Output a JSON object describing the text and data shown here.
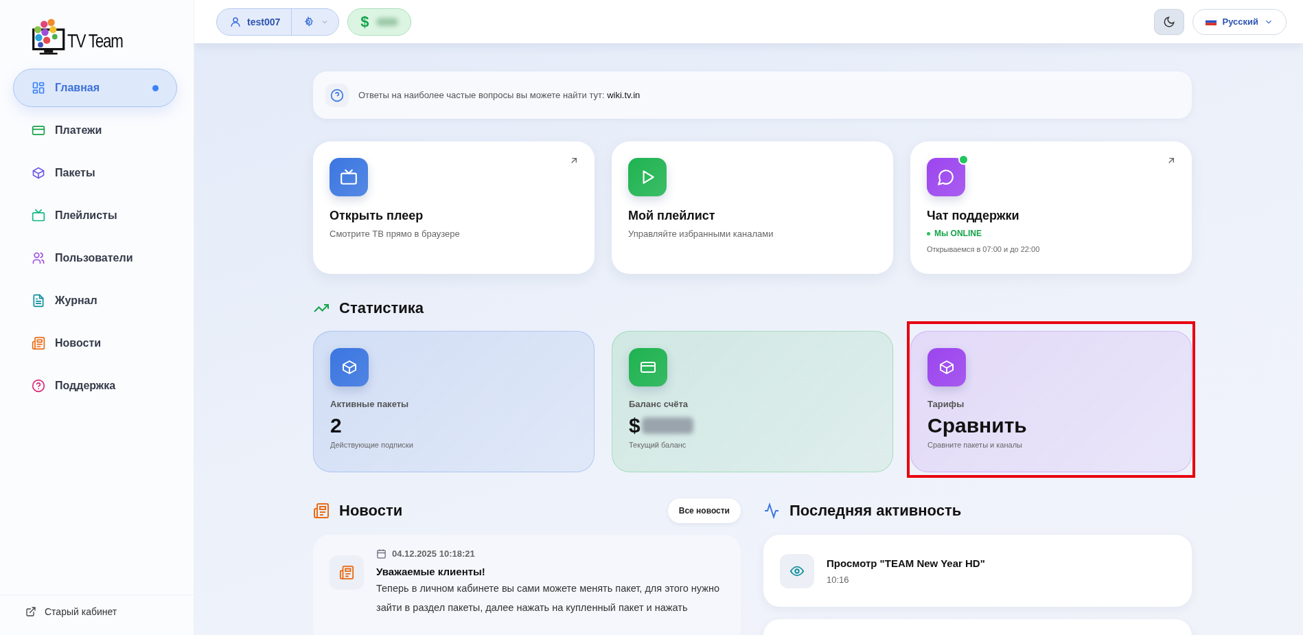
{
  "logo": {
    "text": "TV Team"
  },
  "sidebar": {
    "items": [
      {
        "label": "Главная",
        "selected": true,
        "color": "#3b82f6"
      },
      {
        "label": "Платежи",
        "selected": false,
        "color": "#16a34a"
      },
      {
        "label": "Пакеты",
        "selected": false,
        "color": "#6d5be6"
      },
      {
        "label": "Плейлисты",
        "selected": false,
        "color": "#10b981"
      },
      {
        "label": "Пользователи",
        "selected": false,
        "color": "#9b4fe0"
      },
      {
        "label": "Журнал",
        "selected": false,
        "color": "#0e8f9c"
      },
      {
        "label": "Новости",
        "selected": false,
        "color": "#ea6a12"
      },
      {
        "label": "Поддержка",
        "selected": false,
        "color": "#db2777"
      }
    ],
    "footer_link": "Старый кабинет"
  },
  "topbar": {
    "user": "test007",
    "balance_symbol": "$",
    "balance_blurred": true,
    "language": "Русский"
  },
  "help": {
    "text": "Ответы на наиболее частые вопросы вы можете найти тут:",
    "link": "wiki.tv.in"
  },
  "quick_cards": [
    {
      "title": "Открыть плеер",
      "subtitle": "Смотрите ТВ прямо в браузере",
      "color": "#3b76e0",
      "external": true,
      "online": false
    },
    {
      "title": "Мой плейлист",
      "subtitle": "Управляйте избранными каналами",
      "color": "#1fb350",
      "external": false,
      "online": false
    },
    {
      "title": "Чат поддержки",
      "status": "Мы ONLINE",
      "subtitle": "Открываемся в 07:00 и до 22:00",
      "color": "#9c45ee",
      "external": true,
      "online": true
    }
  ],
  "statistics": {
    "title": "Статистика",
    "cards": [
      {
        "label": "Активные пакеты",
        "value": "2",
        "blurred": false,
        "note": "Действующие подписки",
        "color": "#3b76e0",
        "highlighted": false
      },
      {
        "label": "Баланс счёта",
        "value": "$",
        "blurred": true,
        "note": "Текущий баланс",
        "color": "#1fb350",
        "highlighted": false
      },
      {
        "label": "Тарифы",
        "value": "Сравнить",
        "blurred": false,
        "note": "Сравните пакеты и каналы",
        "color": "#9c45ee",
        "highlighted": true
      }
    ]
  },
  "news": {
    "title": "Новости",
    "button": "Все новости",
    "items": [
      {
        "date": "04.12.2025 10:18:21",
        "title": "Уважаемые клиенты!",
        "body": "Теперь в личном кабинете вы сами можете менять пакет, для этого нужно зайти в раздел пакеты, далее нажать на купленный пакет и нажать"
      }
    ]
  },
  "activity": {
    "title": "Последняя активность",
    "items": [
      {
        "title": "Просмотр \"TEAM New Year HD\"",
        "time": "10:16"
      }
    ]
  }
}
